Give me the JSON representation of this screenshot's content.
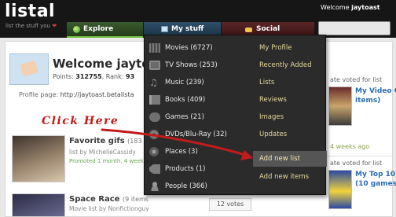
{
  "header": {
    "logo": "listal",
    "tagline": "list the stuff you",
    "tagline_heart": "❤",
    "welcome_prefix": "Welcome",
    "username": "jaytoast",
    "search_value": ""
  },
  "nav": {
    "tabs": [
      {
        "label": "Explore",
        "icon": "globe-icon"
      },
      {
        "label": "My stuff",
        "icon": "folder-icon"
      },
      {
        "label": "Social",
        "icon": "people-icon"
      }
    ]
  },
  "profile": {
    "name": "Welcome jaytoast",
    "points_label": "Points:",
    "points": "312755",
    "rank_label": ", Rank:",
    "rank": "93",
    "page_label": "Profile page:",
    "page_url": "http://jaytoast.betalista"
  },
  "items": [
    {
      "title": "Favorite gifs",
      "count": "(183 ite",
      "by": "list by MichelleCassidy",
      "meta": "Promoted 1 month, 4 weeks ago"
    },
    {
      "title": "Space Race",
      "count": "(9 items",
      "by": "Movie list by Nonfictionguy",
      "votes": "12 votes"
    }
  ],
  "right_col": {
    "voted1": "ate voted for list",
    "list1_line1": "My Video C",
    "list1_line2": "items)",
    "ago": "4 weeks ago",
    "voted2": "ate voted for list",
    "list2_line1": "My Top 10",
    "list2_line2": "(10 games"
  },
  "dropdown": {
    "left": [
      {
        "label": "Movies (6727)",
        "icon": "film-icon"
      },
      {
        "label": "TV Shows (253)",
        "icon": "tv-icon"
      },
      {
        "label": "Music (239)",
        "icon": "music-icon"
      },
      {
        "label": "Books (409)",
        "icon": "book-icon"
      },
      {
        "label": "Games (21)",
        "icon": "gamepad-icon"
      },
      {
        "label": "DVDs/Blu-Ray (32)",
        "icon": "disc-icon"
      },
      {
        "label": "Places (3)",
        "icon": "place-icon"
      },
      {
        "label": "Products (1)",
        "icon": "tag-icon"
      },
      {
        "label": "People (366)",
        "icon": "person-icon"
      }
    ],
    "right": [
      {
        "label": "My Profile"
      },
      {
        "label": "Recently Added"
      },
      {
        "label": "Lists"
      },
      {
        "label": "Reviews"
      },
      {
        "label": "Images"
      },
      {
        "label": "Updates"
      },
      {
        "label": ""
      },
      {
        "label": "Add new list",
        "active": true
      },
      {
        "label": "Add new items"
      }
    ]
  },
  "annotation": {
    "text": "Click Here",
    "color": "#c21b1b"
  }
}
